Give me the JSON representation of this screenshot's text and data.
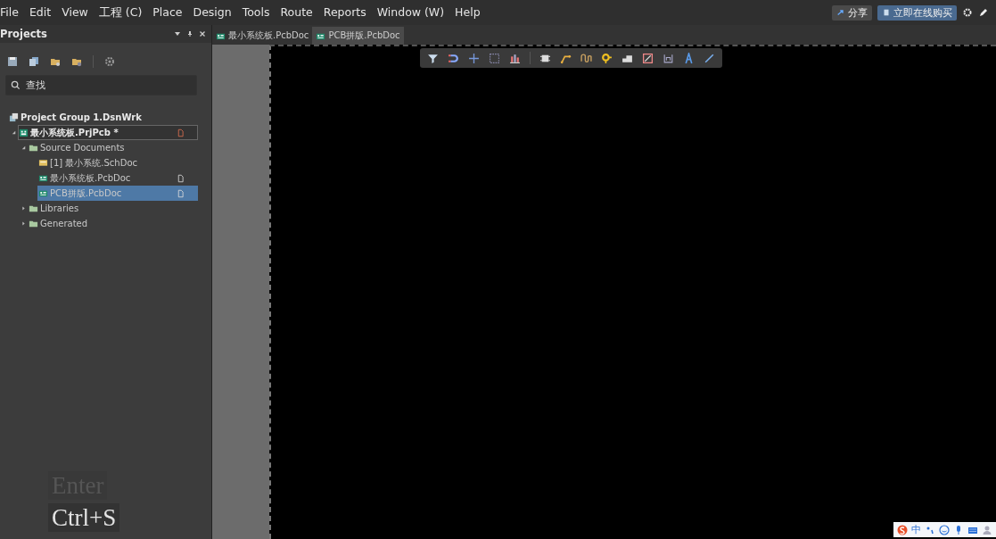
{
  "menu_bar": {
    "items": [
      "File",
      "Edit",
      "View",
      "工程 (C)",
      "Place",
      "Design",
      "Tools",
      "Route",
      "Reports",
      "Window (W)",
      "Help"
    ],
    "buttons": [
      {
        "label": "分享",
        "kind": "share"
      },
      {
        "label": "立即在线购买",
        "kind": "buy"
      }
    ]
  },
  "projects_panel": {
    "title": "Projects",
    "search": {
      "placeholder": "查找"
    },
    "tree": [
      {
        "label": "Project Group 1.DsnWrk",
        "kind": "group",
        "children": [
          {
            "label": "最小系统板.PrjPcb *",
            "kind": "project",
            "expanded": true,
            "focused": true,
            "open": true,
            "modified": true,
            "children": [
              {
                "label": "Source Documents",
                "kind": "folder",
                "expanded": true,
                "selected": false,
                "children": [
                  {
                    "label": "[1] 最小系统.SchDoc",
                    "kind": "sch",
                    "selected": false
                  },
                  {
                    "label": "最小系统板.PcbDoc",
                    "kind": "pcb",
                    "selected": false,
                    "open": true,
                    "modified": false
                  },
                  {
                    "label": "PCB拼版.PcbDoc",
                    "kind": "pcb",
                    "selected": true,
                    "open": true,
                    "modified": false
                  }
                ]
              },
              {
                "label": "Libraries",
                "kind": "folder",
                "expanded": false,
                "selected": false
              },
              {
                "label": "Generated",
                "kind": "folder",
                "expanded": false,
                "selected": false
              }
            ]
          }
        ]
      }
    ]
  },
  "document_tabs": [
    {
      "label": "最小系统板.PcbDoc",
      "selected": false
    },
    {
      "label": "PCB拼版.PcbDoc",
      "selected": true
    }
  ],
  "key_overlay": [
    {
      "label": "Enter",
      "faded": true
    },
    {
      "label": "Ctrl+S",
      "faded": false
    }
  ],
  "ime_bar": {
    "label": "中"
  }
}
